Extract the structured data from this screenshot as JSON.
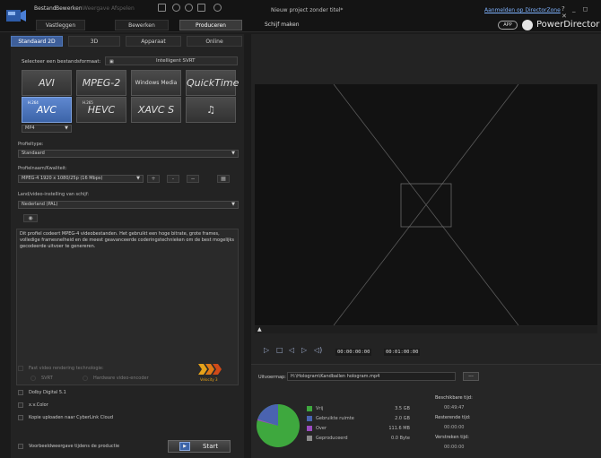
{
  "app": {
    "project_title": "Nieuw project zonder titel*",
    "login_link": "Aanmelden op DirectorZone",
    "window_controls": "? _ ◻ ✕",
    "brand": "PowerDirector",
    "app_badge": "APP"
  },
  "menu": {
    "items": [
      "Bestand",
      "Bewerken",
      "Weergave",
      "Afspelen"
    ]
  },
  "mode_tabs": [
    "Vastleggen",
    "Bewerken",
    "Produceren",
    "Schijf maken"
  ],
  "format_tabs": [
    "Standaard 2D",
    "3D",
    "Apparaat",
    "Online"
  ],
  "select_format": {
    "label": "Selecteer een bestandsformaat:",
    "srt_label": "Intelligent SVRT"
  },
  "formats": [
    {
      "label": "AVI",
      "sup": ""
    },
    {
      "label": "MPEG-2",
      "sup": ""
    },
    {
      "label": "Windows Media",
      "sup": ""
    },
    {
      "label": "QuickTime",
      "sup": ""
    },
    {
      "label": "AVC",
      "sup": "H.264"
    },
    {
      "label": "HEVC",
      "sup": "H.265"
    },
    {
      "label": "XAVC S",
      "sup": ""
    },
    {
      "label": "♫",
      "sup": ""
    }
  ],
  "container": {
    "value": "MP4"
  },
  "profile_type": {
    "label": "Profieltype:",
    "value": "Standaard"
  },
  "profile_quality": {
    "label": "Profielnaam/Kwaliteit:",
    "value": "MPEG-4 1920 x 1080/25p (16 Mbps)",
    "add": "+",
    "minus": "-",
    "edit": "−"
  },
  "country": {
    "label": "Land/video-instelling van schijf:",
    "value": "Nederland (PAL)"
  },
  "description": "Dit profiel codeert MPEG-4 videobestanden. Het gebruikt een hoge bitrate, grote frames, volledige framesnelheid en de meest geavanceerde coderingstechnieken om de best mogelijks gecodeerde uitvoer te genereren.",
  "options": {
    "fast_rendering": "Fast video rendering technologie:",
    "svrt": "SVRT",
    "hw_encoder": "Hardware video-encoder",
    "dolby": "Dolby Digital 5.1",
    "xvcolor": "x.v.Color",
    "upload": "Kopie uploaden naar CyberLink Cloud",
    "preview": "Voorbeeldweergave tijdens de productie",
    "velocity": "Velocity 3"
  },
  "start_button": {
    "label": "Start",
    "icon": "▶"
  },
  "player": {
    "current_time": "00:00:00:00",
    "total_time": "00:01:00:00"
  },
  "output": {
    "label": "Uitvoermap:",
    "path": "H:\\Hologram\\Kandballen hologram.mp4",
    "browse": "..."
  },
  "disk_usage": {
    "items": [
      {
        "label": "Vrij",
        "value": "3.5 GB",
        "color": "#3ea83e"
      },
      {
        "label": "Gebruikte ruimte",
        "value": "2.0 GB",
        "color": "#4a63b0"
      },
      {
        "label": "Over",
        "value": "111.6 MB",
        "color": "#9a4cc0"
      },
      {
        "label": "Geproduceerd",
        "value": "0.0 Byte",
        "color": "#8a8a8a"
      }
    ]
  },
  "times": {
    "elapsed_label": "Beschikbare tijd:",
    "elapsed_value": "00:49:47",
    "remaining_label": "Resterende tijd:",
    "remaining_value": "00:00:00",
    "total_label": "Verstreken tijd:",
    "total_value": "00:00:00"
  },
  "colors": {
    "accent": "#3e64a8",
    "disk_free": "#3ea83e",
    "disk_used": "#4a63b0"
  }
}
